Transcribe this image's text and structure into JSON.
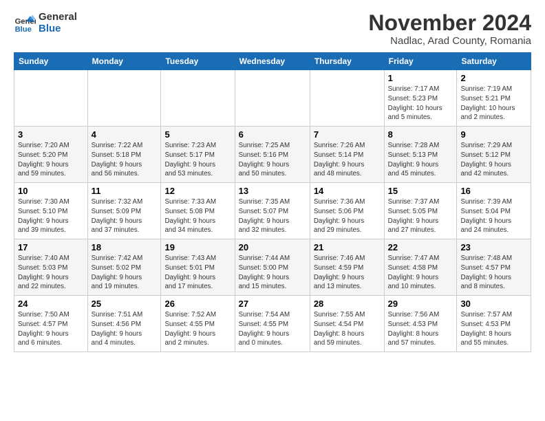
{
  "logo": {
    "line1": "General",
    "line2": "Blue"
  },
  "title": "November 2024",
  "location": "Nadlac, Arad County, Romania",
  "days_header": [
    "Sunday",
    "Monday",
    "Tuesday",
    "Wednesday",
    "Thursday",
    "Friday",
    "Saturday"
  ],
  "weeks": [
    [
      {
        "day": "",
        "info": ""
      },
      {
        "day": "",
        "info": ""
      },
      {
        "day": "",
        "info": ""
      },
      {
        "day": "",
        "info": ""
      },
      {
        "day": "",
        "info": ""
      },
      {
        "day": "1",
        "info": "Sunrise: 7:17 AM\nSunset: 5:23 PM\nDaylight: 10 hours\nand 5 minutes."
      },
      {
        "day": "2",
        "info": "Sunrise: 7:19 AM\nSunset: 5:21 PM\nDaylight: 10 hours\nand 2 minutes."
      }
    ],
    [
      {
        "day": "3",
        "info": "Sunrise: 7:20 AM\nSunset: 5:20 PM\nDaylight: 9 hours\nand 59 minutes."
      },
      {
        "day": "4",
        "info": "Sunrise: 7:22 AM\nSunset: 5:18 PM\nDaylight: 9 hours\nand 56 minutes."
      },
      {
        "day": "5",
        "info": "Sunrise: 7:23 AM\nSunset: 5:17 PM\nDaylight: 9 hours\nand 53 minutes."
      },
      {
        "day": "6",
        "info": "Sunrise: 7:25 AM\nSunset: 5:16 PM\nDaylight: 9 hours\nand 50 minutes."
      },
      {
        "day": "7",
        "info": "Sunrise: 7:26 AM\nSunset: 5:14 PM\nDaylight: 9 hours\nand 48 minutes."
      },
      {
        "day": "8",
        "info": "Sunrise: 7:28 AM\nSunset: 5:13 PM\nDaylight: 9 hours\nand 45 minutes."
      },
      {
        "day": "9",
        "info": "Sunrise: 7:29 AM\nSunset: 5:12 PM\nDaylight: 9 hours\nand 42 minutes."
      }
    ],
    [
      {
        "day": "10",
        "info": "Sunrise: 7:30 AM\nSunset: 5:10 PM\nDaylight: 9 hours\nand 39 minutes."
      },
      {
        "day": "11",
        "info": "Sunrise: 7:32 AM\nSunset: 5:09 PM\nDaylight: 9 hours\nand 37 minutes."
      },
      {
        "day": "12",
        "info": "Sunrise: 7:33 AM\nSunset: 5:08 PM\nDaylight: 9 hours\nand 34 minutes."
      },
      {
        "day": "13",
        "info": "Sunrise: 7:35 AM\nSunset: 5:07 PM\nDaylight: 9 hours\nand 32 minutes."
      },
      {
        "day": "14",
        "info": "Sunrise: 7:36 AM\nSunset: 5:06 PM\nDaylight: 9 hours\nand 29 minutes."
      },
      {
        "day": "15",
        "info": "Sunrise: 7:37 AM\nSunset: 5:05 PM\nDaylight: 9 hours\nand 27 minutes."
      },
      {
        "day": "16",
        "info": "Sunrise: 7:39 AM\nSunset: 5:04 PM\nDaylight: 9 hours\nand 24 minutes."
      }
    ],
    [
      {
        "day": "17",
        "info": "Sunrise: 7:40 AM\nSunset: 5:03 PM\nDaylight: 9 hours\nand 22 minutes."
      },
      {
        "day": "18",
        "info": "Sunrise: 7:42 AM\nSunset: 5:02 PM\nDaylight: 9 hours\nand 19 minutes."
      },
      {
        "day": "19",
        "info": "Sunrise: 7:43 AM\nSunset: 5:01 PM\nDaylight: 9 hours\nand 17 minutes."
      },
      {
        "day": "20",
        "info": "Sunrise: 7:44 AM\nSunset: 5:00 PM\nDaylight: 9 hours\nand 15 minutes."
      },
      {
        "day": "21",
        "info": "Sunrise: 7:46 AM\nSunset: 4:59 PM\nDaylight: 9 hours\nand 13 minutes."
      },
      {
        "day": "22",
        "info": "Sunrise: 7:47 AM\nSunset: 4:58 PM\nDaylight: 9 hours\nand 10 minutes."
      },
      {
        "day": "23",
        "info": "Sunrise: 7:48 AM\nSunset: 4:57 PM\nDaylight: 9 hours\nand 8 minutes."
      }
    ],
    [
      {
        "day": "24",
        "info": "Sunrise: 7:50 AM\nSunset: 4:57 PM\nDaylight: 9 hours\nand 6 minutes."
      },
      {
        "day": "25",
        "info": "Sunrise: 7:51 AM\nSunset: 4:56 PM\nDaylight: 9 hours\nand 4 minutes."
      },
      {
        "day": "26",
        "info": "Sunrise: 7:52 AM\nSunset: 4:55 PM\nDaylight: 9 hours\nand 2 minutes."
      },
      {
        "day": "27",
        "info": "Sunrise: 7:54 AM\nSunset: 4:55 PM\nDaylight: 9 hours\nand 0 minutes."
      },
      {
        "day": "28",
        "info": "Sunrise: 7:55 AM\nSunset: 4:54 PM\nDaylight: 8 hours\nand 59 minutes."
      },
      {
        "day": "29",
        "info": "Sunrise: 7:56 AM\nSunset: 4:53 PM\nDaylight: 8 hours\nand 57 minutes."
      },
      {
        "day": "30",
        "info": "Sunrise: 7:57 AM\nSunset: 4:53 PM\nDaylight: 8 hours\nand 55 minutes."
      }
    ]
  ]
}
